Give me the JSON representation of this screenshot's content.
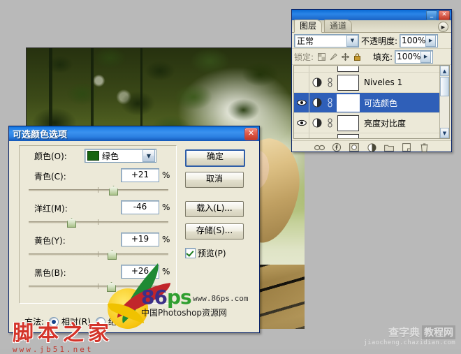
{
  "document": {
    "photo_alt": "woman lying on wooden deck with green foliage background"
  },
  "selective_color_dialog": {
    "title": "可选颜色选项",
    "close_label": "✕",
    "color_label": "颜色(O):",
    "color_value": "绿色",
    "color_swatch_hex": "#15640e",
    "sliders": [
      {
        "label": "青色(C):",
        "value": "+21",
        "unit": "%",
        "percent": 21
      },
      {
        "label": "洋红(M):",
        "value": "-46",
        "unit": "%",
        "percent": -46
      },
      {
        "label": "黄色(Y):",
        "value": "+19",
        "unit": "%",
        "percent": 19
      },
      {
        "label": "黑色(B):",
        "value": "+26",
        "unit": "%",
        "percent": 26
      }
    ],
    "buttons": {
      "ok": "确定",
      "cancel": "取消",
      "load": "载入(L)...",
      "save": "存储(S)..."
    },
    "preview_label": "预览(P)",
    "preview_checked": true,
    "method_label": "方法:",
    "method_relative": "相对(R)",
    "method_absolute": "绝对(A)",
    "method_selected": "relative"
  },
  "logo_86ps": {
    "mark": "86",
    "mark_p": "ps",
    "url": "www.86ps.com",
    "tagline": "中国Photoshop资源网"
  },
  "watermark_jb51": {
    "title": "脚本之家",
    "url": "www.jb51.net"
  },
  "watermark_chazidian": {
    "part1": "查字典",
    "part2": "教程网",
    "url": "jiaocheng.chazidian.com"
  },
  "layers_palette": {
    "minimize_label": "_",
    "close_label": "✕",
    "menu_label": "▶",
    "tabs": [
      {
        "label": "图层",
        "active": true
      },
      {
        "label": "通道",
        "active": false
      }
    ],
    "blend_mode": "正常",
    "opacity_label": "不透明度:",
    "opacity_value": "100%",
    "lock_label": "锁定:",
    "fill_label": "填充:",
    "fill_value": "100%",
    "layers": [
      {
        "name": "Niveles 1",
        "visible": false,
        "selected": false
      },
      {
        "name": "可选颜色",
        "visible": true,
        "selected": true
      },
      {
        "name": "亮度对比度",
        "visible": true,
        "selected": false
      }
    ],
    "footer_icons": [
      "link-icon",
      "layer-style-icon",
      "layer-mask-icon",
      "adjustment-layer-icon",
      "new-group-icon",
      "new-layer-icon",
      "delete-layer-icon"
    ]
  }
}
